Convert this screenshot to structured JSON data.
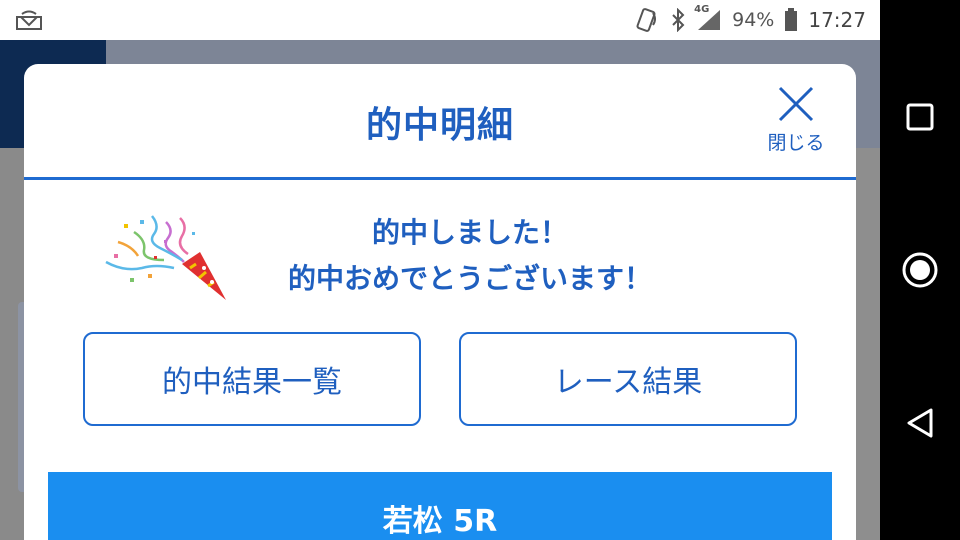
{
  "status_bar": {
    "battery_percent": "94%",
    "time": "17:27",
    "network": "4G"
  },
  "modal": {
    "title": "的中明細",
    "close_label": "閉じる",
    "message_line1": "的中しました！",
    "message_line2": "的中おめでとうございます！",
    "button_hit_results": "的中結果一覧",
    "button_race_results": "レース結果",
    "race_label": "若松 5R"
  },
  "colors": {
    "accent": "#1f5fbf",
    "race_bar": "#1a8ef0"
  }
}
